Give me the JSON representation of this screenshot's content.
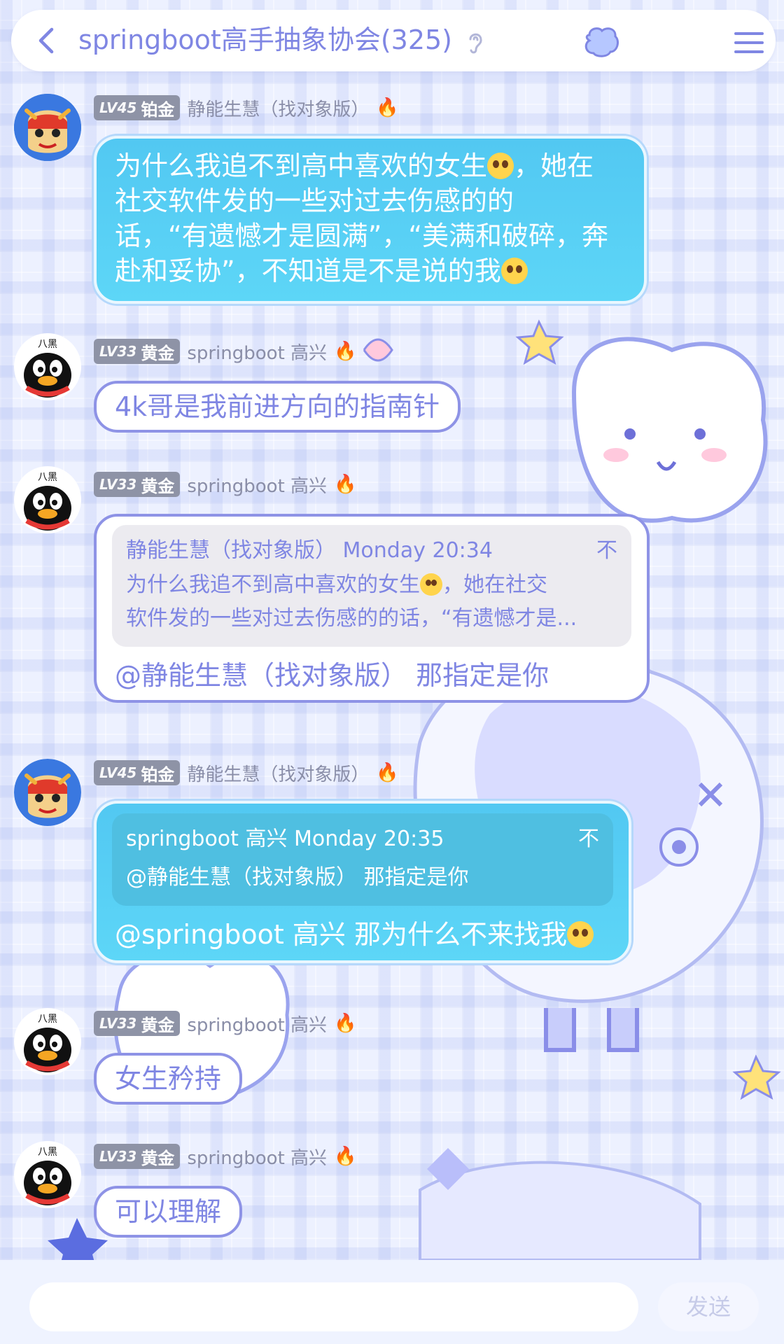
{
  "header": {
    "title": "springboot高手抽象协会(325)",
    "icons": [
      "back-arrow-icon",
      "ear-icon",
      "cloud-icon",
      "menu-icon"
    ]
  },
  "messages": [
    {
      "badge": {
        "level": "LV45",
        "rank": "铂金"
      },
      "user": "静能生慧（找对象版）",
      "avatar": "red-dragon-avatar",
      "style": "blue",
      "lines": [
        "为什么我追不到高中喜欢的女生",
        "，她在",
        "社交软件发的一些对过去伤感的的",
        "话，“有遗憾才是圆满”，“美满和破碎，奔",
        "赴和妥协”，不知道是不是说的我"
      ]
    },
    {
      "badge": {
        "level": "LV33",
        "rank": "黄金"
      },
      "user": "springboot 高兴",
      "avatar": "penguin-avatar",
      "style": "white",
      "text": "4k哥是我前进方向的指南针"
    },
    {
      "badge": {
        "level": "LV33",
        "rank": "黄金"
      },
      "user": "springboot 高兴",
      "avatar": "penguin-avatar",
      "style": "white",
      "quote": {
        "author_time": "静能生慧（找对象版） Monday 20:34",
        "line1": "为什么我追不到高中喜欢的女生",
        "line1_tail": "，她在社交",
        "line2": "软件发的一些对过去伤感的的话，“有遗憾才是..."
      },
      "text": "@静能生慧（找对象版） 那指定是你"
    },
    {
      "badge": {
        "level": "LV45",
        "rank": "铂金"
      },
      "user": "静能生慧（找对象版）",
      "avatar": "red-dragon-avatar",
      "style": "blue",
      "quote": {
        "author_time": "springboot 高兴 Monday 20:35",
        "line1": "@静能生慧（找对象版） 那指定是你"
      },
      "text": "@springboot 高兴 那为什么不来找我"
    },
    {
      "badge": {
        "level": "LV33",
        "rank": "黄金"
      },
      "user": "springboot 高兴",
      "avatar": "penguin-avatar",
      "style": "white",
      "text": "女生矜持"
    },
    {
      "badge": {
        "level": "LV33",
        "rank": "黄金"
      },
      "user": "springboot 高兴",
      "avatar": "penguin-avatar",
      "style": "white",
      "text": "可以理解"
    }
  ],
  "quote_pin_icon": "不",
  "footer": {
    "input_placeholder": "",
    "send_label": "发送"
  },
  "colors": {
    "accent": "#7f86e3",
    "bubble_blue": "#55cdf4",
    "badge_grey": "#8e93a6",
    "fire": "#ff7a1a"
  }
}
